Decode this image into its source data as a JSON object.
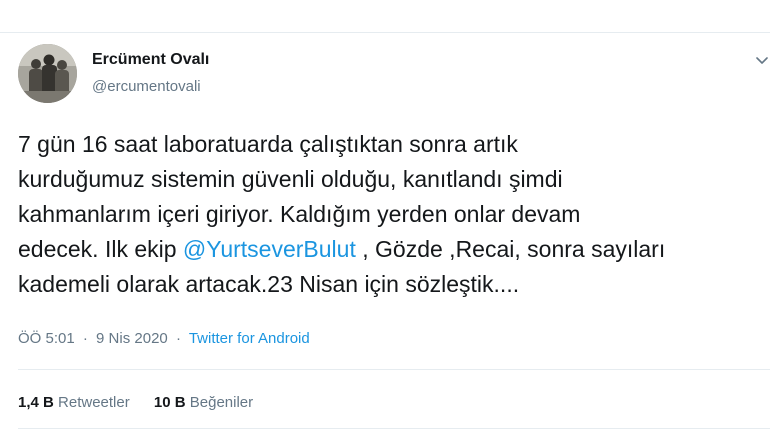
{
  "tweet": {
    "author": {
      "name": "Ercüment Ovalı",
      "handle": "@ercumentovali"
    },
    "text": {
      "line1": "7 gün 16 saat laboratuarda çalıştıktan sonra artık",
      "line2": "kurduğumuz sistemin güvenli olduğu, kanıtlandı şimdi",
      "line3": "kahmanlarım içeri giriyor. Kaldığım yerden onlar devam",
      "line4_pre": "edecek. Ilk ekip ",
      "line4_mention": "@YurtseverBulut",
      "line4_post": " , Gözde ,Recai, sonra sayıları",
      "line5": "kademeli olarak artacak.23 Nisan için  sözleştik...."
    },
    "meta": {
      "time": "ÖÖ 5:01",
      "date": "9 Nis 2020",
      "separator1": "·",
      "separator2": "·",
      "source": "Twitter for Android"
    },
    "stats": {
      "retweets_count": "1,4 B",
      "retweets_label": "Retweetler",
      "likes_count": "10 B",
      "likes_label": "Beğeniler"
    }
  },
  "colors": {
    "link": "#1b95e0",
    "secondary_text": "#657786",
    "primary_text": "#14171a",
    "divider": "#e6ecf0"
  },
  "icons": {
    "more": "chevron-down-icon"
  }
}
